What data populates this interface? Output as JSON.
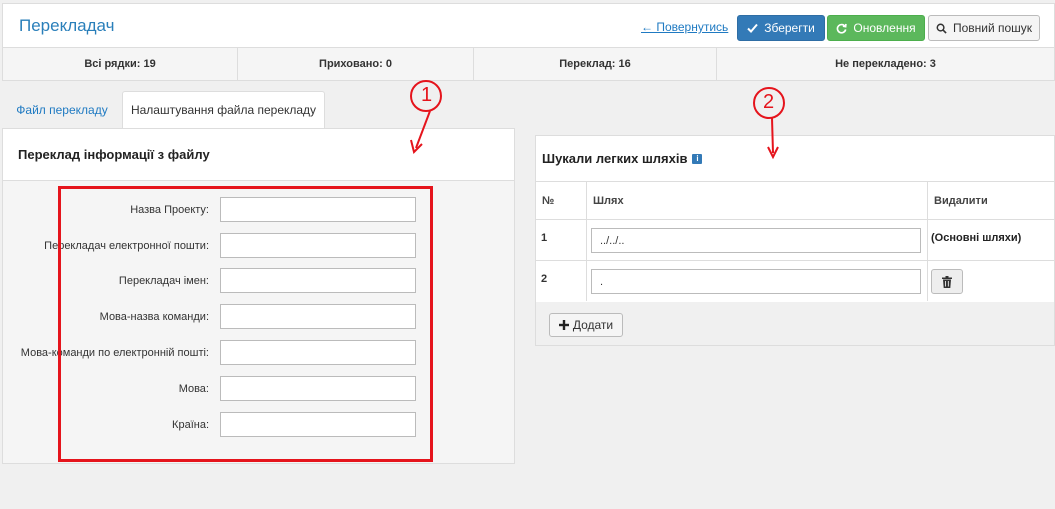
{
  "header": {
    "title": "Перекладач",
    "back_link": "← Повернутись",
    "save_label": "Зберегти",
    "update_label": "Оновлення",
    "search_label": "Повний пошук"
  },
  "stats": [
    {
      "label": "Всі рядки: 19"
    },
    {
      "label": "Приховано: 0"
    },
    {
      "label": "Переклад: 16"
    },
    {
      "label": "Не перекладено: 3"
    }
  ],
  "tabs": [
    {
      "label": "Файл перекладу",
      "active": false
    },
    {
      "label": "Налаштування файла перекладу",
      "active": true
    }
  ],
  "file_info": {
    "title": "Переклад інформації з файлу",
    "fields": [
      {
        "label": "Назва Проекту:",
        "value": ""
      },
      {
        "label": "Перекладач електронної пошти:",
        "value": ""
      },
      {
        "label": "Перекладач імен:",
        "value": ""
      },
      {
        "label": "Мова-назва команди:",
        "value": ""
      },
      {
        "label": "Мова-команди по електронній пошті:",
        "value": ""
      },
      {
        "label": "Мова:",
        "value": ""
      },
      {
        "label": "Країна:",
        "value": ""
      }
    ]
  },
  "scan_paths": {
    "title": "Шукали легких шляхів",
    "info_glyph": "i",
    "columns": {
      "num": "№",
      "path": "Шлях",
      "delete": "Видалити"
    },
    "rows": [
      {
        "num": "1",
        "path": "../../..",
        "delete_text": "(Основні шляхи)"
      },
      {
        "num": "2",
        "path": ".",
        "delete_text": ""
      }
    ],
    "add_label": "Додати"
  },
  "annotations": [
    {
      "label": "1"
    },
    {
      "label": "2"
    }
  ],
  "colors": {
    "accent": "#337ab7",
    "success": "#5cb85c",
    "link": "#1f7ac2",
    "annotation": "#e5141c"
  }
}
